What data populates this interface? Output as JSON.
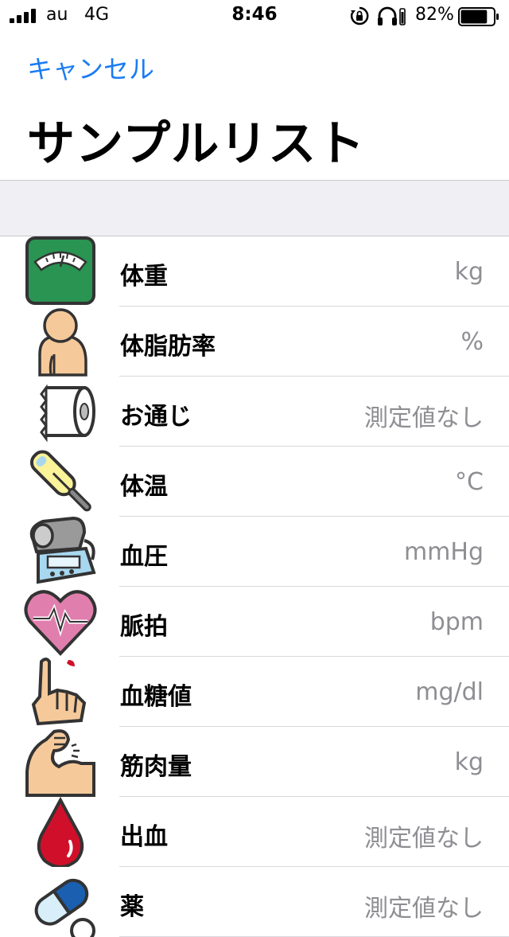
{
  "status_bar": {
    "carrier": "au",
    "network": "4G",
    "time": "8:46",
    "battery": "82%",
    "signal_bars": 4,
    "battery_level": 0.82
  },
  "nav": {
    "cancel_label": "キャンセル",
    "title": "サンプルリスト"
  },
  "colors": {
    "accent": "#1a7cf3",
    "value_text": "#8e8e93",
    "section_background": "#efeff4",
    "separator": "#d9d9de"
  },
  "list": {
    "items": [
      {
        "label": "体重",
        "value": "kg",
        "icon": "scale-icon"
      },
      {
        "label": "体脂肪率",
        "value": "%",
        "icon": "body-icon"
      },
      {
        "label": "お通じ",
        "value": "測定値なし",
        "icon": "toilet-paper-icon"
      },
      {
        "label": "体温",
        "value": "°C",
        "icon": "thermometer-icon"
      },
      {
        "label": "血圧",
        "value": "mmHg",
        "icon": "blood-pressure-monitor-icon"
      },
      {
        "label": "脈拍",
        "value": "bpm",
        "icon": "heart-pulse-icon"
      },
      {
        "label": "血糖値",
        "value": "mg/dl",
        "icon": "finger-blood-icon"
      },
      {
        "label": "筋肉量",
        "value": "kg",
        "icon": "muscle-arm-icon"
      },
      {
        "label": "出血",
        "value": "測定値なし",
        "icon": "blood-drop-icon"
      },
      {
        "label": "薬",
        "value": "測定値なし",
        "icon": "pill-icon"
      }
    ]
  }
}
